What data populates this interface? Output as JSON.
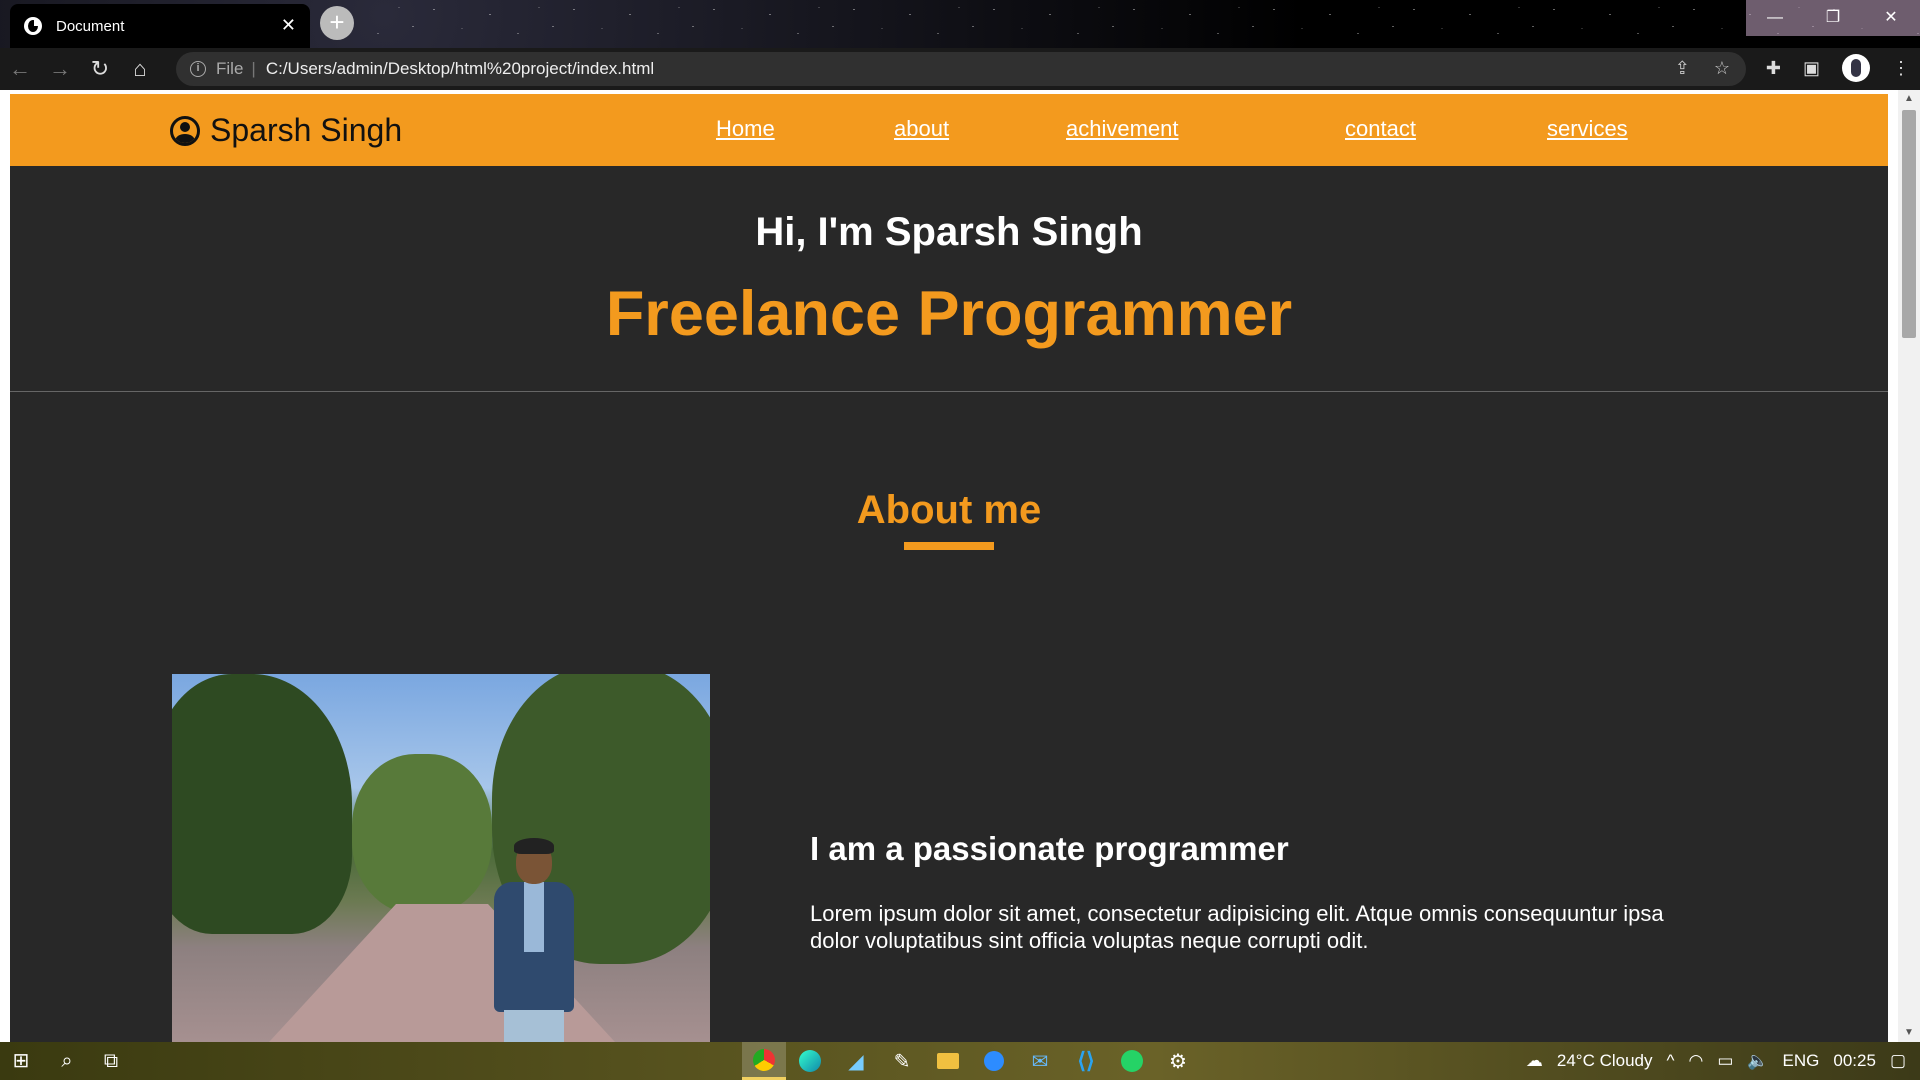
{
  "browser": {
    "tab_title": "Document",
    "tab_close": "✕",
    "new_tab": "+",
    "url_scheme": "File",
    "url_separator": "|",
    "url": "C:/Users/admin/Desktop/html%20project/index.html",
    "win_min": "—",
    "win_restore": "❐",
    "win_close": "✕"
  },
  "site": {
    "brand": "Sparsh Singh",
    "nav": [
      "Home",
      "about",
      "achivement",
      "contact",
      "services"
    ],
    "hero": {
      "greeting": "Hi, I'm Sparsh Singh",
      "role": "Freelance Programmer"
    },
    "about": {
      "title": "About me",
      "heading": "I am a passionate programmer",
      "text": "Lorem ipsum dolor sit amet, consectetur adipisicing elit. Atque omnis consequuntur ipsa dolor voluptatibus sint officia voluptas neque corrupti odit."
    }
  },
  "taskbar": {
    "weather": "24°C  Cloudy",
    "language": "ENG",
    "time": "00:25"
  },
  "colors": {
    "accent": "#f39a1e",
    "page_bg": "#282828"
  }
}
